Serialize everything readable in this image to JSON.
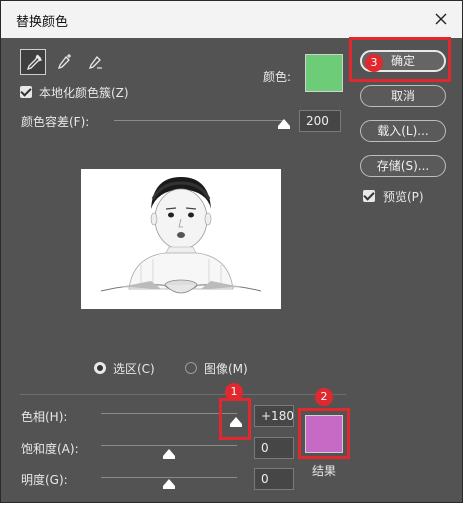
{
  "window": {
    "title": "替换颜色"
  },
  "tools": [
    {
      "name": "eyedropper-tool-icon"
    },
    {
      "name": "add-to-sample-icon"
    },
    {
      "name": "subtract-from-sample-icon"
    }
  ],
  "localized_clusters": {
    "label": "本地化颜色簇(Z)",
    "checked": true
  },
  "color": {
    "label": "颜色:",
    "swatch": "#6ccc78"
  },
  "fuzziness": {
    "label": "颜色容差(F):",
    "value": "200",
    "level_percent": 100
  },
  "buttons": {
    "ok": "确定",
    "cancel": "取消",
    "load": "载入(L)...",
    "save": "存储(S)..."
  },
  "preview": {
    "label": "预览(P)",
    "checked": true
  },
  "view_mode": {
    "selection": "选区(C)",
    "image": "图像(M)",
    "selected": "selection"
  },
  "hue": {
    "label": "色相(H):",
    "value": "+180"
  },
  "saturation": {
    "label": "饱和度(A):",
    "value": "0"
  },
  "lightness": {
    "label": "明度(G):",
    "value": "0"
  },
  "result": {
    "label": "结果",
    "swatch": "#c76ac6"
  },
  "annotations": {
    "marker_1": "1",
    "marker_2": "2",
    "marker_3": "3",
    "color": "#e0282e"
  }
}
